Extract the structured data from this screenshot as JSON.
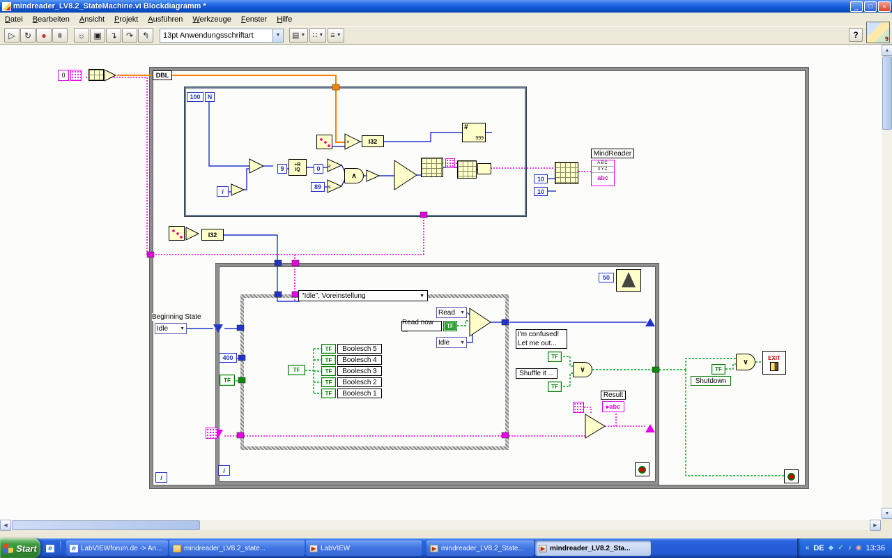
{
  "window": {
    "title": "mindreader_LV8.2_StateMachine.vi Blockdiagramm *",
    "min": "_",
    "max": "□",
    "close": "×"
  },
  "menubar": {
    "items": [
      "Datei",
      "Bearbeiten",
      "Ansicht",
      "Projekt",
      "Ausführen",
      "Werkzeuge",
      "Fenster",
      "Hilfe"
    ]
  },
  "toolbar": {
    "font_selector": "13pt Anwendungsschriftart",
    "help_label": "?",
    "icon_badge": "9"
  },
  "icons": {
    "run": "▷",
    "run_cont": "↻",
    "abort": "●",
    "pause": "II",
    "bulb": "☼",
    "retain": "▣",
    "step_into": "↴",
    "step_over": "↷",
    "step_out": "↰",
    "align": "▤",
    "distribute": "∷",
    "reorder": "≡",
    "caret": "▼",
    "up": "▲",
    "down": "▼",
    "left": "◀",
    "right": "▶",
    "multiply": "×",
    "and": "∧",
    "or": "∨",
    "ge": "≥",
    "le": "≤",
    "qr_top": "÷R",
    "qr_bottom": "IQ",
    "tri_r": "▸",
    "chevrons": "«",
    "tray_a": "◆",
    "tray_b": "✓",
    "tray_c": "♪",
    "tray_d": "◉"
  },
  "diagram": {
    "dbl": "DBL",
    "for_count": "100",
    "for_n": "N",
    "iter": "i",
    "c0_top": "0",
    "c9": "9",
    "c0": "0",
    "c89": "89",
    "c10a": "10",
    "c10b": "10",
    "c400": "400",
    "c50": "50",
    "i32": "I32",
    "fmt_hash": "#",
    "fmt_nines": "999",
    "mindreader": "MindReader",
    "mr_row1": "ABC",
    "mr_row2": "XYZ",
    "mr_abc": "abc",
    "beginning_state": "Beginning State",
    "idle_const": "Idle",
    "case_selector": "\"Idle\", Voreinstellung",
    "read_enum": "Read",
    "read_now": "Read now ...",
    "idle_enum": "Idle",
    "tf": "TF",
    "booleans": [
      "Boolesch 5",
      "Boolesch 4",
      "Boolesch 3",
      "Boolesch 2",
      "Boolesch 1"
    ],
    "confused1": "I'm confused!",
    "confused2": "Let me out...",
    "shuffle": "Shuffle it ...",
    "result": "Result",
    "result_abc": "abc",
    "shutdown": "Shutdown",
    "exit": "EXIT"
  },
  "taskbar": {
    "start": "Start",
    "tasks": [
      "LabVIEWforum.de -> An...",
      "mindreader_LV8.2_state...",
      "LabVIEW",
      "mindreader_LV8.2_State...",
      "mindreader_LV8.2_Sta..."
    ],
    "lang": "DE",
    "time": "13:36"
  }
}
